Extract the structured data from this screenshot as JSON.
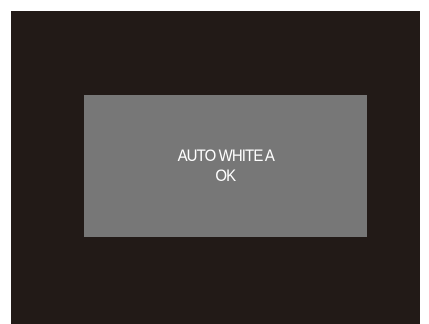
{
  "dialog": {
    "message_line1": "AUTO WHITE A",
    "message_line2": "OK"
  },
  "colors": {
    "screen_background": "#221a17",
    "dialog_background": "#777777",
    "text": "#ffffff"
  }
}
